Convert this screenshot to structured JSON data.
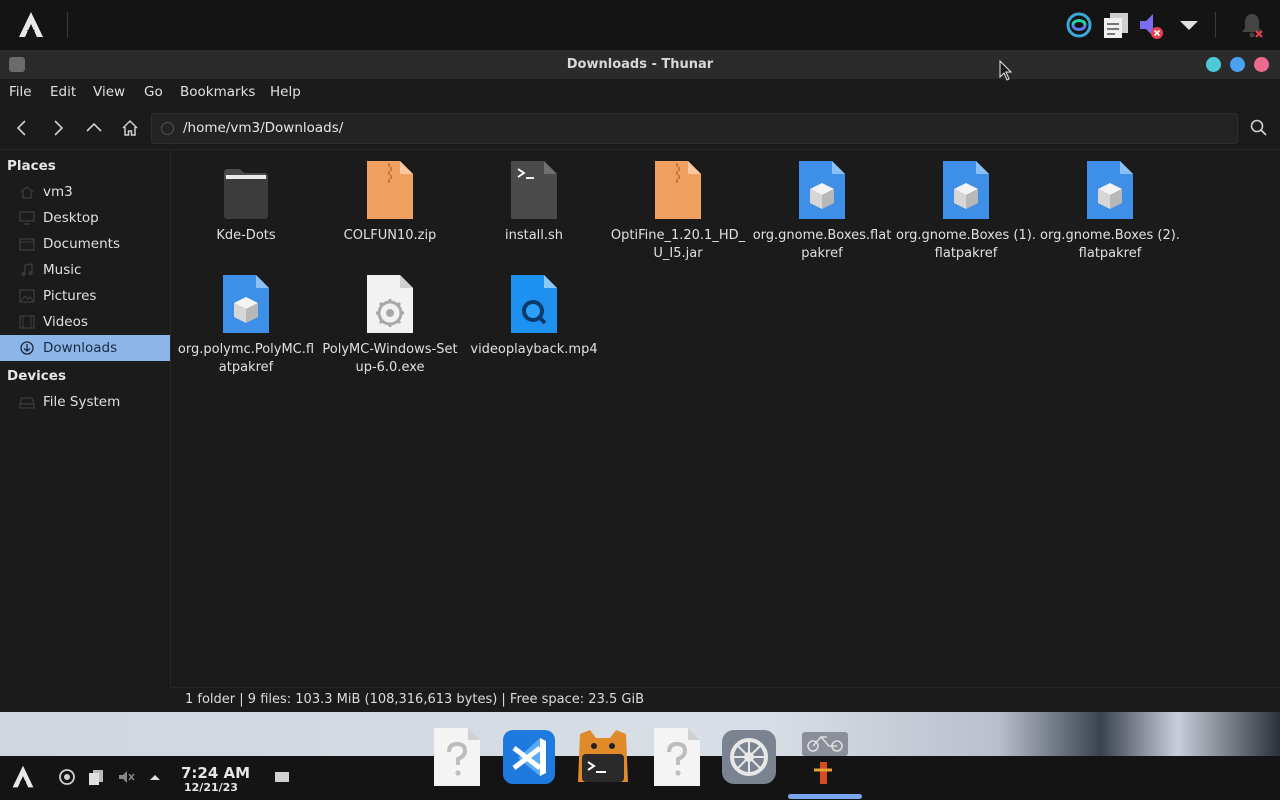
{
  "top_panel": {
    "icons": [
      "arch-logo-icon",
      "sync-icon",
      "clipboard-icon",
      "volume-muted-icon",
      "tray-expand-icon",
      "notification-bell-muted-icon"
    ]
  },
  "window": {
    "title": "Downloads - Thunar",
    "menu": [
      "File",
      "Edit",
      "View",
      "Go",
      "Bookmarks",
      "Help"
    ],
    "location": "/home/vm3/Downloads/"
  },
  "sidebar": {
    "places_heading": "Places",
    "places": [
      {
        "label": "vm3",
        "icon": "home-folder-icon"
      },
      {
        "label": "Desktop",
        "icon": "desktop-icon"
      },
      {
        "label": "Documents",
        "icon": "documents-icon"
      },
      {
        "label": "Music",
        "icon": "music-icon"
      },
      {
        "label": "Pictures",
        "icon": "pictures-icon"
      },
      {
        "label": "Videos",
        "icon": "videos-icon"
      },
      {
        "label": "Downloads",
        "icon": "downloads-icon",
        "active": true
      }
    ],
    "devices_heading": "Devices",
    "devices": [
      {
        "label": "File System",
        "icon": "drive-icon"
      }
    ]
  },
  "files": [
    {
      "name": "Kde-Dots",
      "type": "folder"
    },
    {
      "name": "COLFUN10.zip",
      "type": "archive"
    },
    {
      "name": "install.sh",
      "type": "script"
    },
    {
      "name": "OptiFine_1.20.1_HD_U_I5.jar",
      "type": "archive"
    },
    {
      "name": "org.gnome.Boxes.flatpakref",
      "type": "flatpak"
    },
    {
      "name": "org.gnome.Boxes (1).flatpakref",
      "type": "flatpak"
    },
    {
      "name": "org.gnome.Boxes (2).flatpakref",
      "type": "flatpak"
    },
    {
      "name": "org.polymc.PolyMC.flatpakref",
      "type": "flatpak"
    },
    {
      "name": "PolyMC-Windows-Setup-6.0.exe",
      "type": "exe"
    },
    {
      "name": "videoplayback.mp4",
      "type": "video"
    }
  ],
  "status": "1 folder  |  9 files: 103.3 MiB (108,316,613 bytes)  |  Free space: 23.5 GiB",
  "bottom_panel": {
    "time": "7:24 AM",
    "date": "12/21/23"
  },
  "dock": [
    "unknown-app-icon",
    "vscode-icon",
    "terminal-cat-icon",
    "unknown-app-icon",
    "settings-icon",
    "bike-app-icon"
  ],
  "colors": {
    "accent": "#8cb5e8",
    "archive": "#f0a060",
    "flatpak": "#3d8fe8"
  }
}
